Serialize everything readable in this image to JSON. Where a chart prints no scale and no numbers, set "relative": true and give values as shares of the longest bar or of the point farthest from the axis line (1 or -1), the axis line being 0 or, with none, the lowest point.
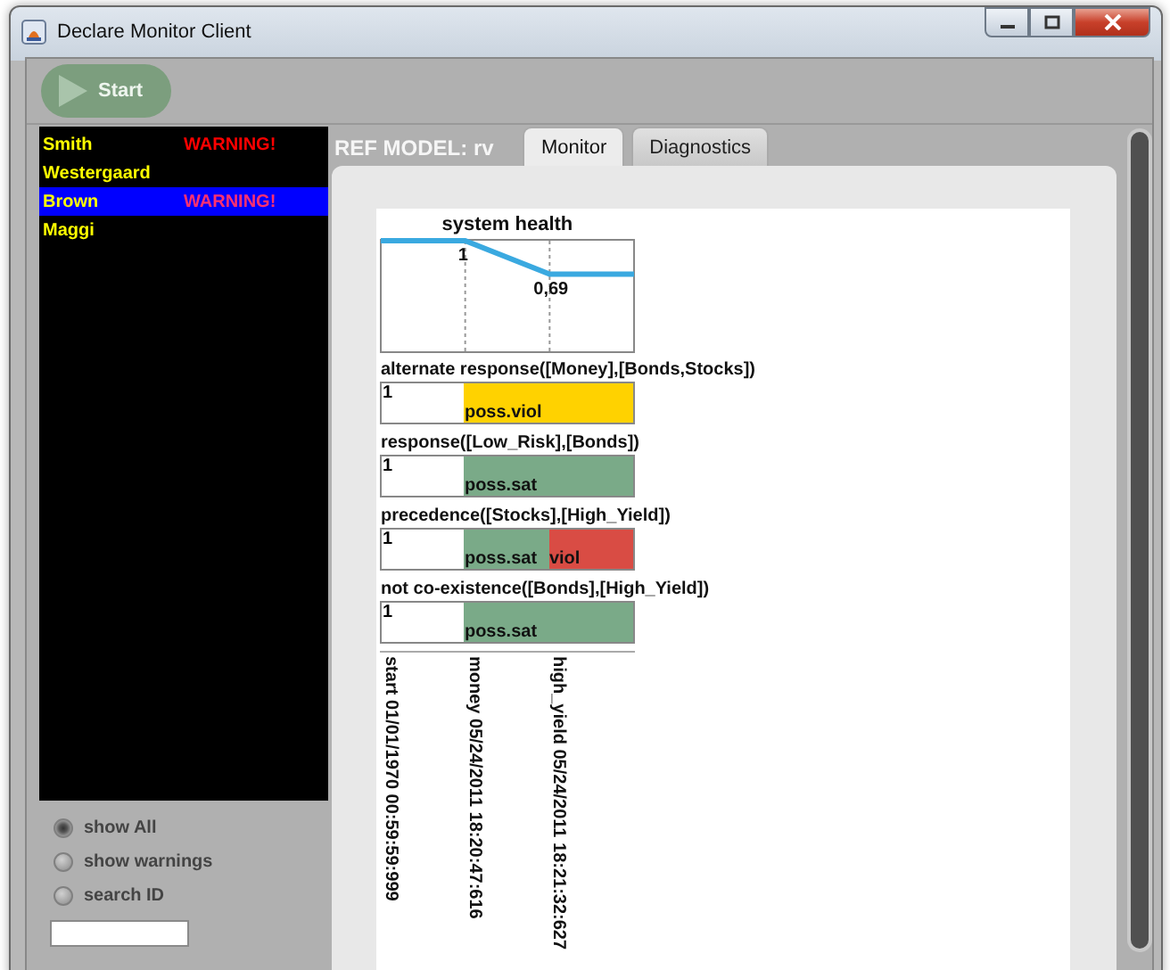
{
  "window": {
    "title": "Declare Monitor Client"
  },
  "toolbar": {
    "start_button": {
      "label": "Start",
      "disabled": true
    }
  },
  "clients": [
    {
      "name": "Smith",
      "warning": "WARNING!",
      "selected": false
    },
    {
      "name": "Westergaard",
      "selected": false
    },
    {
      "name": "Brown",
      "warning": "WARNING!",
      "selected": true
    },
    {
      "name": "Maggi",
      "selected": false
    }
  ],
  "filters": [
    {
      "label": "show All",
      "selected": true
    },
    {
      "label": "show warnings",
      "selected": false
    },
    {
      "label": "search ID",
      "selected": false
    }
  ],
  "ref_model": "REF MODEL: rv",
  "tabs": [
    {
      "label": "Monitor",
      "selected": true
    },
    {
      "label": "Diagnostics",
      "selected": false
    }
  ],
  "health_chart": {
    "chart_data": {
      "type": "line",
      "title": "system health",
      "categories": [
        null,
        null,
        null,
        null
      ],
      "series": [
        {
          "color": "#3aa9e0",
          "values": [
            1,
            1,
            0.69,
            0.69
          ]
        }
      ],
      "relative": true,
      "ylim": [
        0,
        1
      ],
      "value_labels": [
        null,
        "1",
        "0,69",
        null
      ]
    }
  },
  "constraints": [
    {
      "name": "alternate response([Money],[Bonds,Stocks])",
      "value": "1",
      "cells": [
        {
          "label": "poss.viol",
          "color": "#ffd200"
        },
        {
          "color": "#ffd200"
        }
      ]
    },
    {
      "name": "response([Low_Risk],[Bonds])",
      "value": "1",
      "cells": [
        {
          "label": "poss.sat",
          "color": "#7aaa88"
        },
        {
          "color": "#7aaa88"
        }
      ]
    },
    {
      "name": "precedence([Stocks],[High_Yield])",
      "value": "1",
      "cells": [
        {
          "label": "poss.sat",
          "color": "#7aaa88"
        },
        {
          "label": "viol",
          "color": "#d94c44"
        }
      ]
    },
    {
      "name": "not co-existence([Bonds],[High_Yield])",
      "value": "1",
      "cells": [
        {
          "label": "poss.sat",
          "color": "#7aaa88"
        },
        {
          "color": "#7aaa88"
        }
      ]
    }
  ],
  "events": [
    "start 01/01/1970 00:59:59:999",
    "money 05/24/2011 18:20:47:616",
    "high_yield 05/24/2011 18:21:32:627"
  ]
}
